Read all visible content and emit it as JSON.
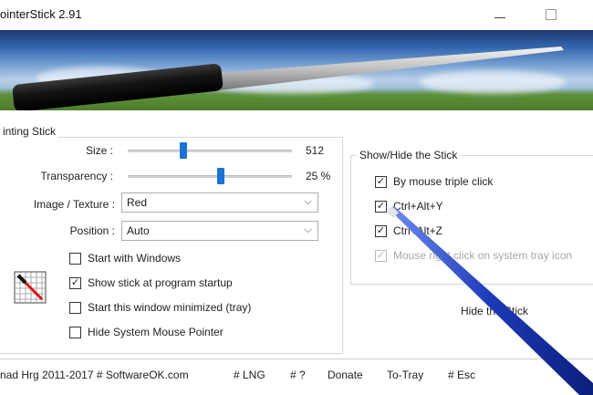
{
  "window": {
    "title": "ointerStick 2.91",
    "minimize": "—",
    "maximize": "☐"
  },
  "pointing_stick": {
    "group_label": "inting Stick",
    "size": {
      "label": "Size :",
      "value": "512",
      "level": 0.33
    },
    "transparency": {
      "label": "Transparency :",
      "value": "25 %",
      "level": 0.57
    },
    "image_texture": {
      "label": "Image / Texture :",
      "selected": "Red"
    },
    "position": {
      "label": "Position :",
      "selected": "Auto"
    },
    "checkboxes": {
      "start_with_windows": {
        "label": "Start with Windows",
        "checked": false
      },
      "show_stick_startup": {
        "label": "Show stick at program startup",
        "checked": true
      },
      "start_minimized": {
        "label": "Start this window minimized (tray)",
        "checked": false
      },
      "hide_system_pointer": {
        "label": "Hide System Mouse Pointer",
        "checked": false
      }
    }
  },
  "show_hide": {
    "group_label": "Show/Hide the Stick",
    "checkboxes": {
      "triple_click": {
        "label": "By mouse triple click",
        "checked": true
      },
      "ctrl_alt_y": {
        "label": "Ctrl+Alt+Y",
        "checked": true
      },
      "ctrl_alt_z": {
        "label": "Ctrl+Alt+Z",
        "checked": true
      },
      "tray_right_click": {
        "label": "Mouse right click on system tray icon",
        "checked": true,
        "disabled": true
      }
    },
    "hide_button": "Hide the Stick"
  },
  "footer": {
    "copyright": "nad Hrg 2011-2017 # SoftwareOK.com",
    "lng": "# LNG",
    "help": "# ?",
    "donate": "Donate",
    "to_tray": "To-Tray",
    "esc": "# Esc"
  },
  "colors": {
    "accent": "#1b73d3",
    "stick_body": "#1f3fb8",
    "stick_tip": "#d8d8d8"
  },
  "icons": {
    "chevron": "chevron-down-icon",
    "check": "checkmark-icon",
    "app": "pointer-stick-app-icon"
  }
}
